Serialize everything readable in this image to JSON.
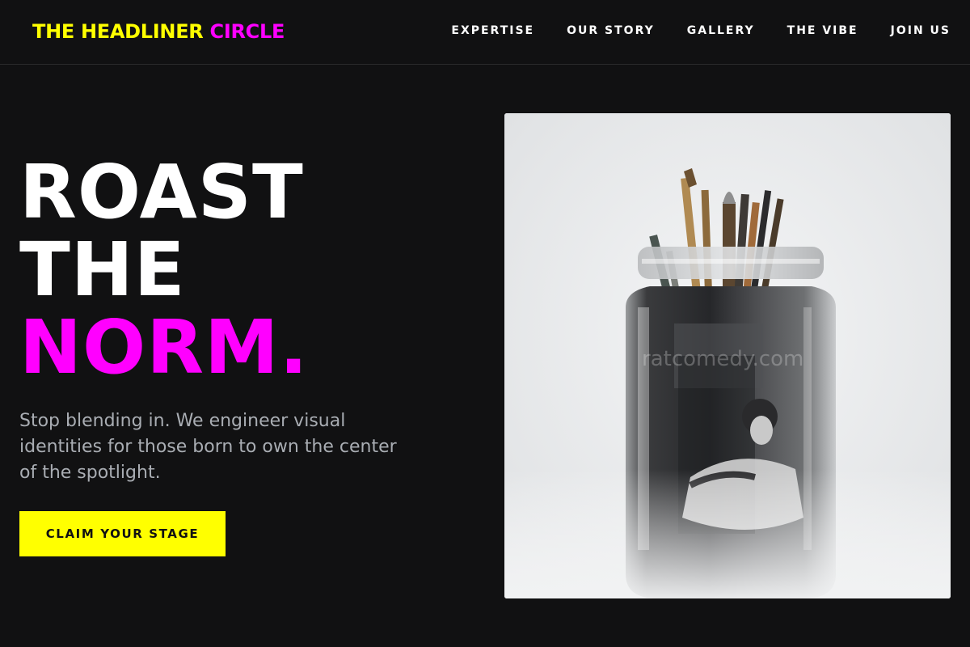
{
  "brand": {
    "part1": "THE HEADLINER",
    "part2": "CIRCLE"
  },
  "nav": {
    "items": [
      {
        "label": "EXPERTISE"
      },
      {
        "label": "OUR STORY"
      },
      {
        "label": "GALLERY"
      },
      {
        "label": "THE VIBE"
      },
      {
        "label": "JOIN US"
      }
    ]
  },
  "hero": {
    "line1": "ROAST",
    "line2": "THE",
    "line3": "NORM.",
    "subtitle": "Stop blending in. We engineer visual identities for those born to own the center of the spotlight.",
    "cta_label": "CLAIM YOUR STAGE",
    "image_watermark": "ratcomedy.com"
  },
  "colors": {
    "background": "#111112",
    "accent_yellow": "#ffff00",
    "accent_magenta": "#ff00ff",
    "subtitle_gray": "#a9adb3"
  }
}
